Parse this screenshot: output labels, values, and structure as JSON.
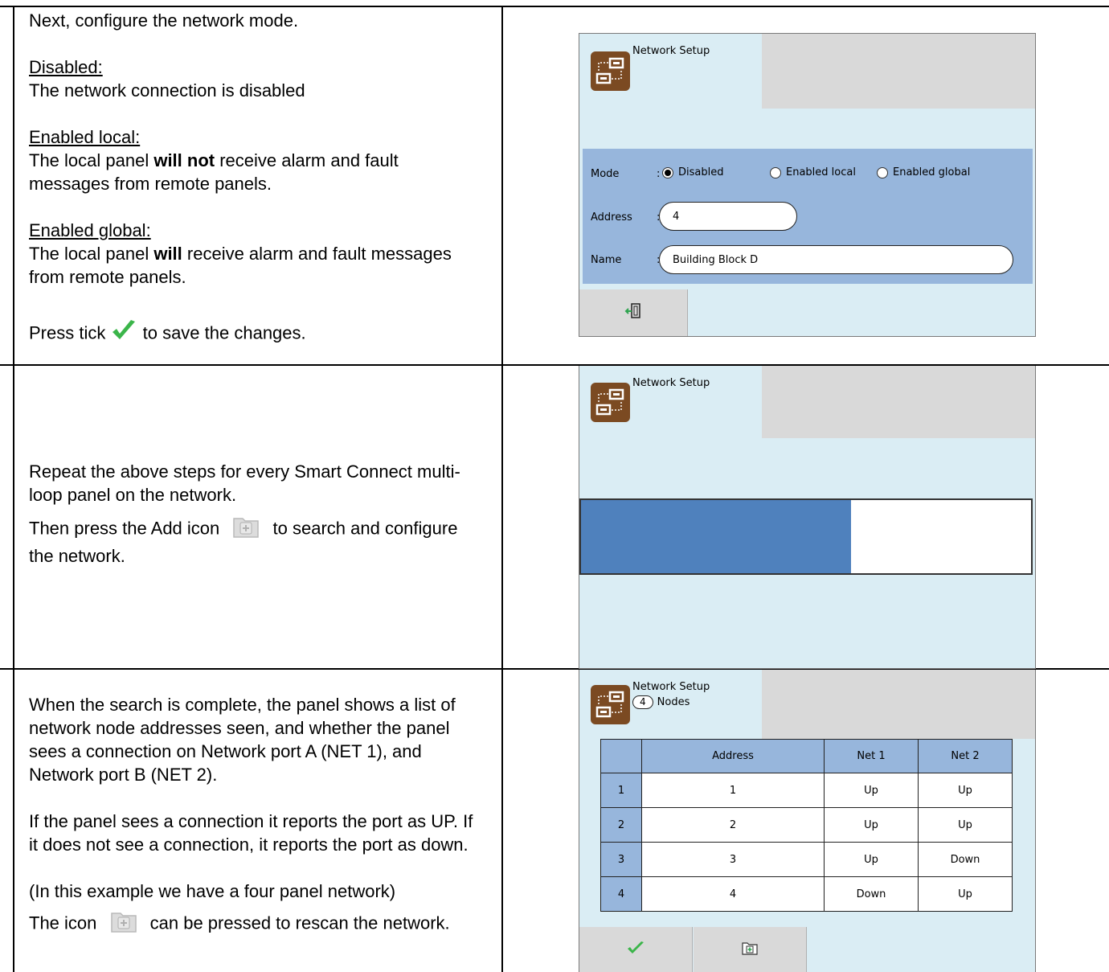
{
  "row1": {
    "intro": "Next, configure the network mode.",
    "disabled_heading": "Disabled:",
    "disabled_text": "The network connection is disabled",
    "local_heading": "Enabled local:",
    "local_line1_pre": "The local panel ",
    "local_line1_bold": "will not",
    "local_line1_post": " receive alarm and fault",
    "local_line2": "messages from remote panels.",
    "global_heading": "Enabled global:",
    "global_line1_pre": "The local panel ",
    "global_line1_bold": "will",
    "global_line1_post": " receive alarm and fault messages",
    "global_line2": "from remote panels.",
    "tick_pre": "Press tick",
    "tick_post": "to save the changes."
  },
  "row2": {
    "line1": "Repeat the above steps for every Smart Connect multi-",
    "line2": "loop panel on the network.",
    "add_pre": "Then press the Add icon",
    "add_post": "to search and configure",
    "add_line2": "the network."
  },
  "row3": {
    "p1_l1": "When the search is complete, the panel shows a list of",
    "p1_l2": "network node addresses seen, and whether the panel",
    "p1_l3": "sees a connection on Network port A (NET 1), and",
    "p1_l4": "Network port B (NET 2).",
    "p2_l1": "If the panel sees a connection it reports the port as UP. If",
    "p2_l2": "it does not see a connection, it reports the port as down.",
    "p3": "(In this example we have a four panel network)",
    "icon_pre": "The icon",
    "icon_post": "can be pressed to rescan the network."
  },
  "screen1": {
    "title": "Network Setup",
    "mode_label": "Mode",
    "colon": ":",
    "modes": [
      "Disabled",
      "Enabled local",
      "Enabled global"
    ],
    "selected_mode": "Disabled",
    "address_label": "Address",
    "address_value": "4",
    "name_label": "Name",
    "name_value": "Building Block D",
    "icon": "network-setup-icon",
    "exit_icon": "exit-icon"
  },
  "screen2": {
    "title": "Network Setup",
    "progress_fraction": 0.6
  },
  "screen3": {
    "title": "Network Setup",
    "node_count": "4",
    "nodes_label": "Nodes",
    "columns": [
      "",
      "Address",
      "Net 1",
      "Net 2"
    ],
    "rows": [
      [
        "1",
        "1",
        "Up",
        "Up"
      ],
      [
        "2",
        "2",
        "Up",
        "Up"
      ],
      [
        "3",
        "3",
        "Up",
        "Down"
      ],
      [
        "4",
        "4",
        "Down",
        "Up"
      ]
    ],
    "tick_icon": "tick-icon",
    "add_icon": "add-folder-icon"
  },
  "colors": {
    "screen_bg": "#daedf4",
    "panel_blue": "#97b6dc",
    "progress_blue": "#4f81bd",
    "icon_brown": "#7b4a22",
    "tick_green": "#3bb54a"
  }
}
